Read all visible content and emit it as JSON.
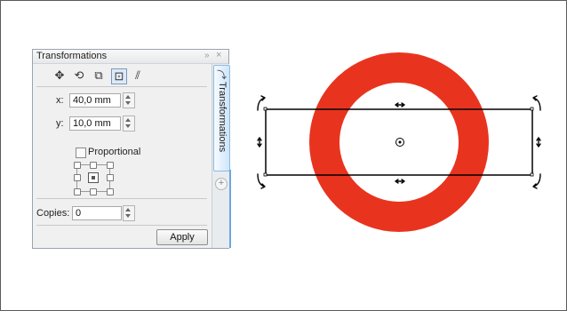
{
  "docker": {
    "title": "Transformations",
    "collapse_glyph": "»",
    "close_glyph": "×",
    "tab_label": "Transformations",
    "add_tab_glyph": "+",
    "mode_buttons": [
      {
        "name": "position-mode-icon",
        "glyph": "✥",
        "active": false
      },
      {
        "name": "rotate-mode-icon",
        "glyph": "⟲",
        "active": false
      },
      {
        "name": "scale-mirror-mode-icon",
        "glyph": "⧉",
        "active": false
      },
      {
        "name": "size-mode-icon",
        "glyph": "⊡",
        "active": true
      },
      {
        "name": "skew-mode-icon",
        "glyph": "⫽",
        "active": false
      }
    ],
    "x_label": "x:",
    "x_value": "40,0 mm",
    "y_label": "y:",
    "y_value": "10,0 mm",
    "proportional_label": "Proportional",
    "proportional_checked": false,
    "copies_label": "Copies:",
    "copies_value": "0",
    "apply_label": "Apply"
  },
  "canvas": {
    "ring_color": "#e8341f",
    "selection_color": "#000000"
  }
}
